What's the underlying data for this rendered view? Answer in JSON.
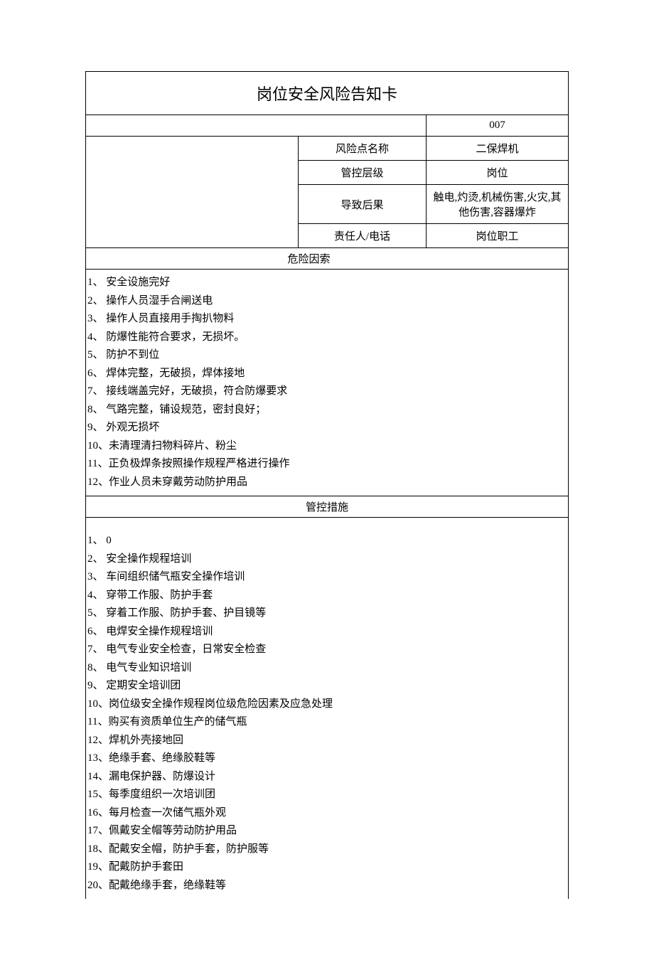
{
  "title": "岗位安全风险告知卡",
  "code": "007",
  "info": [
    {
      "label": "风险点名称",
      "value": "二保焊机"
    },
    {
      "label": "管控层级",
      "value": "岗位"
    },
    {
      "label": "导致后果",
      "value": "触电,灼烫,机械伤害,火灾,其他伤害,容器爆炸"
    },
    {
      "label": "责任人/电话",
      "value": "岗位职工"
    }
  ],
  "section_risk_label_left": "危",
  "section_risk_label_right": "险因索",
  "section_control_label": "管控措施",
  "risk_factors": [
    "1、 安全设施完好",
    "2、 操作人员湿手合闸送电",
    "3、 操作人员直接用手掏扒物料",
    "4、 防爆性能符合要求，无损坏。",
    "5、 防护不到位",
    "6、 焊体完整，无破损，焊体接地",
    "7、 接线端盖完好，无破损，符合防爆要求",
    "8、 气路完整，铺设规范，密封良好；",
    "9、 外观无损坏",
    "10、未清理清扫物料碎片、粉尘",
    "11、正负极焊条按照操作规程严格进行操作",
    "12、作业人员未穿戴劳动防护用品"
  ],
  "control_measures": [
    "1、 0",
    "2、 安全操作规程培训",
    "3、 车间组织储气瓶安全操作培训",
    "4、 穿带工作服、防护手套",
    "5、 穿着工作服、防护手套、护目镜等",
    "6、 电焊安全操作规程培训",
    "7、 电气专业安全检查，日常安全检查",
    "8、 电气专业知识培训",
    "9、 定期安全培训团",
    "10、岗位级安全操作规程岗位级危险因素及应急处理",
    "11、购买有资质单位生产的储气瓶",
    "12、焊机外壳接地回",
    "13、绝缘手套、绝缘胶鞋等",
    "14、漏电保护器、防爆设计",
    "15、每季度组织一次培训团",
    "16、每月检查一次储气瓶外观",
    "17、佩戴安全帽等劳动防护用品",
    "18、配戴安全帽，防护手套，防护服等",
    "19、配戴防护手套田",
    "20、配戴绝缘手套，绝缘鞋等"
  ]
}
